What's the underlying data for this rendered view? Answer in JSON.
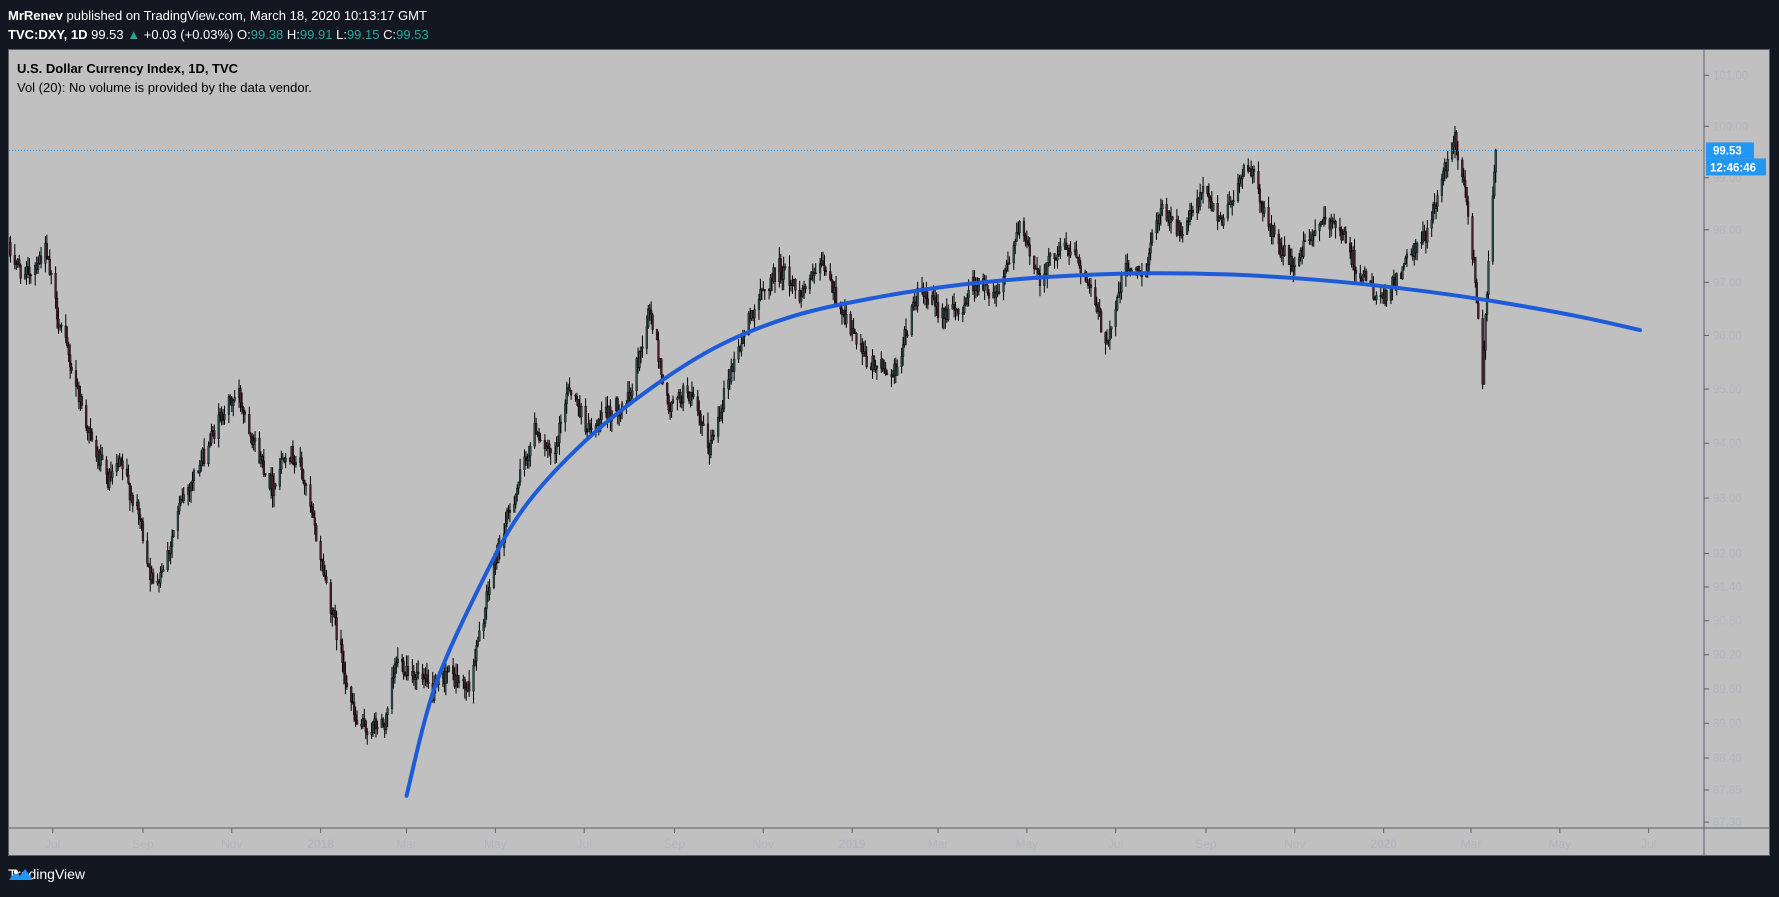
{
  "header": {
    "author": "MrRenev",
    "published": "published on TradingView.com, March 18, 2020 10:13:17 GMT",
    "symbol": "TVC:DXY, 1D",
    "last": "99.53",
    "change": "+0.03 (+0.03%)",
    "o_label": "O:",
    "o": "99.38",
    "h_label": "H:",
    "h": "99.91",
    "l_label": "L:",
    "l": "99.15",
    "c_label": "C:",
    "c": "99.53"
  },
  "legend": {
    "title": "U.S. Dollar Currency Index, 1D, TVC",
    "volume_note": "Vol (20): No volume is provided by the data vendor."
  },
  "footer": {
    "brand": "TradingView"
  },
  "colors": {
    "background": "#131722",
    "plot": "#c0c0c0",
    "up": "#26a69a",
    "candle": "#000000",
    "arc": "#1e5bd8",
    "price_tag": "#2196f3"
  },
  "chart_data": {
    "type": "candlestick",
    "symbol": "TVC:DXY",
    "interval": "1D",
    "last_price": "99.53",
    "countdown": "12:46:46",
    "y_scale": "log",
    "ylim": [
      87.2,
      101.5
    ],
    "y_ticks": [
      "101.00",
      "100.00",
      "99.00",
      "98.00",
      "97.00",
      "96.00",
      "95.00",
      "94.00",
      "93.00",
      "92.00",
      "91.40",
      "90.80",
      "90.20",
      "89.60",
      "89.00",
      "88.40",
      "87.85",
      "87.30"
    ],
    "y_tick_values": [
      101,
      100,
      99,
      98,
      97,
      96,
      95,
      94,
      93,
      92,
      91.4,
      90.8,
      90.2,
      89.6,
      89,
      88.4,
      87.85,
      87.3
    ],
    "x_range": [
      "2017-06-01",
      "2020-08-08"
    ],
    "x_ticks": [
      {
        "label": "Jul",
        "date": "2017-07-01"
      },
      {
        "label": "Sep",
        "date": "2017-09-01"
      },
      {
        "label": "Nov",
        "date": "2017-11-01"
      },
      {
        "label": "2018",
        "date": "2018-01-01",
        "bold": true
      },
      {
        "label": "Mar",
        "date": "2018-03-01"
      },
      {
        "label": "May",
        "date": "2018-05-01"
      },
      {
        "label": "Jul",
        "date": "2018-07-01"
      },
      {
        "label": "Sep",
        "date": "2018-09-01"
      },
      {
        "label": "Nov",
        "date": "2018-11-01"
      },
      {
        "label": "2019",
        "date": "2019-01-01",
        "bold": true
      },
      {
        "label": "Mar",
        "date": "2019-03-01"
      },
      {
        "label": "May",
        "date": "2019-05-01"
      },
      {
        "label": "Jul",
        "date": "2019-07-01"
      },
      {
        "label": "Sep",
        "date": "2019-09-01"
      },
      {
        "label": "Nov",
        "date": "2019-11-01"
      },
      {
        "label": "2020",
        "date": "2020-01-01",
        "bold": true
      },
      {
        "label": "Mar",
        "date": "2020-03-01"
      },
      {
        "label": "May",
        "date": "2020-05-01"
      },
      {
        "label": "Jul",
        "date": "2020-07-01"
      }
    ],
    "price_path": [
      [
        "2017-06-01",
        97.6
      ],
      [
        "2017-06-12",
        97.1
      ],
      [
        "2017-06-26",
        97.6
      ],
      [
        "2017-07-05",
        96.3
      ],
      [
        "2017-07-15",
        95.3
      ],
      [
        "2017-07-28",
        94.0
      ],
      [
        "2017-08-08",
        93.3
      ],
      [
        "2017-08-17",
        93.6
      ],
      [
        "2017-08-30",
        92.6
      ],
      [
        "2017-09-08",
        91.4
      ],
      [
        "2017-09-18",
        92.0
      ],
      [
        "2017-09-28",
        93.0
      ],
      [
        "2017-10-10",
        93.6
      ],
      [
        "2017-10-26",
        94.6
      ],
      [
        "2017-11-06",
        94.9
      ],
      [
        "2017-11-18",
        93.9
      ],
      [
        "2017-11-29",
        93.2
      ],
      [
        "2017-12-08",
        93.9
      ],
      [
        "2017-12-18",
        93.6
      ],
      [
        "2017-12-29",
        92.3
      ],
      [
        "2018-01-12",
        90.6
      ],
      [
        "2018-01-25",
        89.0
      ],
      [
        "2018-02-01",
        88.9
      ],
      [
        "2018-02-15",
        89.0
      ],
      [
        "2018-02-22",
        90.1
      ],
      [
        "2018-03-06",
        89.9
      ],
      [
        "2018-03-20",
        89.5
      ],
      [
        "2018-03-28",
        89.9
      ],
      [
        "2018-04-12",
        89.6
      ],
      [
        "2018-04-20",
        90.5
      ],
      [
        "2018-04-30",
        91.8
      ],
      [
        "2018-05-10",
        92.7
      ],
      [
        "2018-05-29",
        94.3
      ],
      [
        "2018-06-10",
        93.6
      ],
      [
        "2018-06-20",
        95.1
      ],
      [
        "2018-07-05",
        94.2
      ],
      [
        "2018-07-20",
        94.6
      ],
      [
        "2018-08-01",
        94.8
      ],
      [
        "2018-08-15",
        96.5
      ],
      [
        "2018-08-28",
        94.6
      ],
      [
        "2018-09-10",
        95.0
      ],
      [
        "2018-09-25",
        93.9
      ],
      [
        "2018-10-08",
        95.2
      ],
      [
        "2018-10-25",
        96.5
      ],
      [
        "2018-11-12",
        97.3
      ],
      [
        "2018-11-26",
        96.8
      ],
      [
        "2018-12-12",
        97.3
      ],
      [
        "2018-12-28",
        96.3
      ],
      [
        "2019-01-10",
        95.5
      ],
      [
        "2019-01-30",
        95.3
      ],
      [
        "2019-02-15",
        96.8
      ],
      [
        "2019-03-01",
        96.5
      ],
      [
        "2019-03-15",
        96.4
      ],
      [
        "2019-03-25",
        97.0
      ],
      [
        "2019-04-10",
        96.8
      ],
      [
        "2019-04-26",
        98.0
      ],
      [
        "2019-05-10",
        97.1
      ],
      [
        "2019-05-24",
        97.7
      ],
      [
        "2019-06-05",
        97.5
      ],
      [
        "2019-06-25",
        95.9
      ],
      [
        "2019-07-08",
        97.3
      ],
      [
        "2019-07-20",
        97.1
      ],
      [
        "2019-08-01",
        98.5
      ],
      [
        "2019-08-15",
        97.9
      ],
      [
        "2019-08-30",
        98.7
      ],
      [
        "2019-09-12",
        98.2
      ],
      [
        "2019-09-30",
        99.3
      ],
      [
        "2019-10-15",
        98.0
      ],
      [
        "2019-10-30",
        97.3
      ],
      [
        "2019-11-15",
        98.0
      ],
      [
        "2019-11-29",
        98.2
      ],
      [
        "2019-12-15",
        97.2
      ],
      [
        "2019-12-31",
        96.6
      ],
      [
        "2020-01-15",
        97.3
      ],
      [
        "2020-01-30",
        97.9
      ],
      [
        "2020-02-19",
        99.8
      ],
      [
        "2020-02-26",
        98.8
      ],
      [
        "2020-03-04",
        97.1
      ],
      [
        "2020-03-09",
        95.2
      ],
      [
        "2020-03-13",
        97.5
      ],
      [
        "2020-03-18",
        99.53
      ]
    ],
    "annotations": [
      {
        "type": "curve",
        "color": "#1e5bd8",
        "points": [
          [
            "2018-03-01",
            87.75
          ],
          [
            "2018-03-20",
            89.6
          ],
          [
            "2018-04-20",
            91.4
          ],
          [
            "2018-05-20",
            92.8
          ],
          [
            "2018-06-30",
            94.0
          ],
          [
            "2018-08-15",
            95.0
          ],
          [
            "2018-10-01",
            95.8
          ],
          [
            "2018-11-20",
            96.35
          ],
          [
            "2019-01-15",
            96.7
          ],
          [
            "2019-03-15",
            96.95
          ],
          [
            "2019-05-15",
            97.1
          ],
          [
            "2019-07-15",
            97.17
          ],
          [
            "2019-09-15",
            97.15
          ],
          [
            "2019-11-15",
            97.05
          ],
          [
            "2020-01-15",
            96.88
          ],
          [
            "2020-03-15",
            96.65
          ],
          [
            "2020-05-15",
            96.35
          ],
          [
            "2020-06-25",
            96.1
          ]
        ]
      },
      {
        "type": "horizontal-dotted-line",
        "value": 99.53,
        "color": "#2196f3"
      }
    ]
  }
}
